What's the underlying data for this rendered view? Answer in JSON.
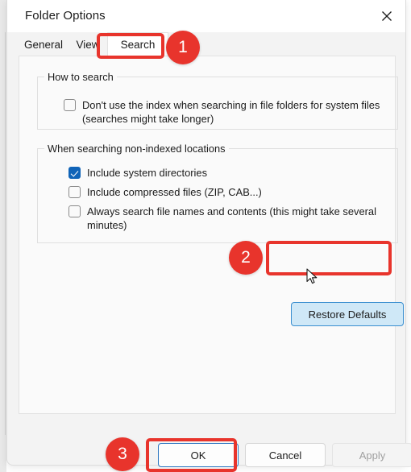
{
  "window": {
    "title": "Folder Options",
    "close_icon": "close-icon"
  },
  "tabs": [
    {
      "label": "General",
      "active": false
    },
    {
      "label": "View",
      "active": false
    },
    {
      "label": "Search",
      "active": true
    }
  ],
  "groups": [
    {
      "legend": "How to search",
      "checkboxes": [
        {
          "label": "Don't use the index when searching in file folders for system files (searches might take longer)",
          "checked": false
        }
      ]
    },
    {
      "legend": "When searching non-indexed locations",
      "checkboxes": [
        {
          "label": "Include system directories",
          "checked": true
        },
        {
          "label": "Include compressed files (ZIP, CAB...)",
          "checked": false
        },
        {
          "label": "Always search file names and contents (this might take several minutes)",
          "checked": false
        }
      ]
    }
  ],
  "buttons": {
    "restore_defaults": "Restore Defaults",
    "ok": "OK",
    "cancel": "Cancel",
    "apply": "Apply"
  },
  "annotations": {
    "badges": [
      {
        "number": "1",
        "target": "search-tab"
      },
      {
        "number": "2",
        "target": "restore-defaults-button"
      },
      {
        "number": "3",
        "target": "ok-button"
      }
    ],
    "color": "#e8342c"
  },
  "colors": {
    "accent_red": "#e8342c",
    "checkbox_checked": "#1064b8",
    "focus_border": "#2a74c0",
    "hover_fill": "#cfe8f7",
    "dialog_bg": "#f3f3f3",
    "page_bg": "#fafafa"
  },
  "cursor": {
    "type": "arrow-pointer"
  }
}
